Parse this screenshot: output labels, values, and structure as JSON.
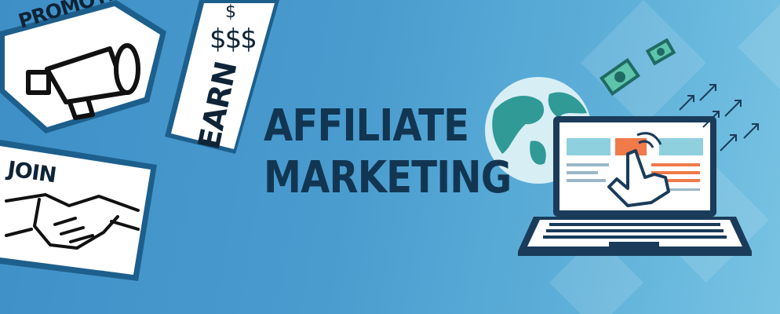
{
  "headline": {
    "line1": "AFFILIATE",
    "line2": "MARKETING"
  },
  "stickers": {
    "promote": "PROMOTE",
    "join": "JOIN",
    "earn": "EARN",
    "dollar_small": "$",
    "dollar_big": "$$$"
  },
  "icons": [
    "megaphone-icon",
    "handshake-icon",
    "globe-icon",
    "laptop-icon",
    "pointing-hand-icon",
    "banknote-icon",
    "arrow-icon"
  ],
  "colors": {
    "background": "#4a9ccf",
    "headline_text": "#123652",
    "sticker_border": "#1d5f8c",
    "sticker_fill": "#ffffff",
    "accent_orange": "#f07a4a",
    "accent_teal": "#7cc6d6"
  }
}
